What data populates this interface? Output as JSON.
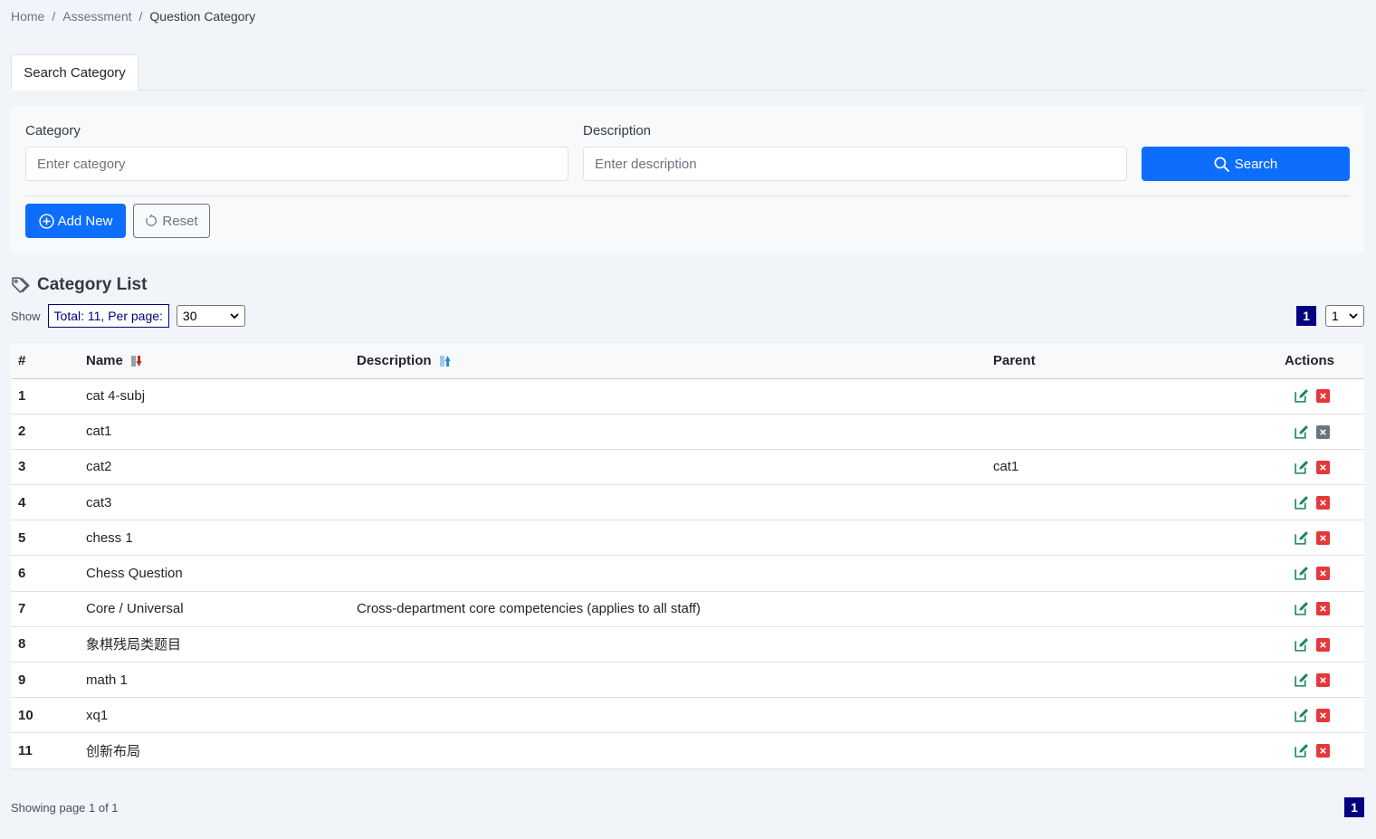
{
  "breadcrumb": {
    "home": "Home",
    "sep": "/",
    "assessment": "Assessment",
    "current": "Question Category"
  },
  "tabs": {
    "search_category": "Search Category"
  },
  "search": {
    "category_label": "Category",
    "category_placeholder": "Enter category",
    "description_label": "Description",
    "description_placeholder": "Enter description",
    "search_button": "Search",
    "add_button": "Add New",
    "reset_button": "Reset"
  },
  "list": {
    "title": "Category List",
    "show_label": "Show",
    "total_text": "Total: 11, Per page:",
    "per_page": "30",
    "current_page": "1",
    "page_select": "1",
    "footer": "Showing page 1 of 1"
  },
  "table": {
    "headers": {
      "num": "#",
      "name": "Name",
      "description": "Description",
      "parent": "Parent",
      "actions": "Actions"
    },
    "rows": [
      {
        "num": "1",
        "name": "cat 4-subj",
        "description": "",
        "parent": "",
        "delete_enabled": true
      },
      {
        "num": "2",
        "name": "cat1",
        "description": "",
        "parent": "",
        "delete_enabled": false
      },
      {
        "num": "3",
        "name": "cat2",
        "description": "",
        "parent": "cat1",
        "delete_enabled": true
      },
      {
        "num": "4",
        "name": "cat3",
        "description": "",
        "parent": "",
        "delete_enabled": true
      },
      {
        "num": "5",
        "name": "chess 1",
        "description": "",
        "parent": "",
        "delete_enabled": true
      },
      {
        "num": "6",
        "name": "Chess Question",
        "description": "",
        "parent": "",
        "delete_enabled": true
      },
      {
        "num": "7",
        "name": "Core / Universal",
        "description": "Cross-department core competencies (applies to all staff)",
        "parent": "",
        "delete_enabled": true
      },
      {
        "num": "8",
        "name": "象棋残局类题目",
        "description": "",
        "parent": "",
        "delete_enabled": true
      },
      {
        "num": "9",
        "name": "math 1",
        "description": "",
        "parent": "",
        "delete_enabled": true
      },
      {
        "num": "10",
        "name": "xq1",
        "description": "",
        "parent": "",
        "delete_enabled": true
      },
      {
        "num": "11",
        "name": "创新布局",
        "description": "",
        "parent": "",
        "delete_enabled": true
      }
    ]
  },
  "colors": {
    "primary": "#0d6efd",
    "navy": "#000080",
    "danger": "#e5383b",
    "edit_icon": "#198754"
  }
}
